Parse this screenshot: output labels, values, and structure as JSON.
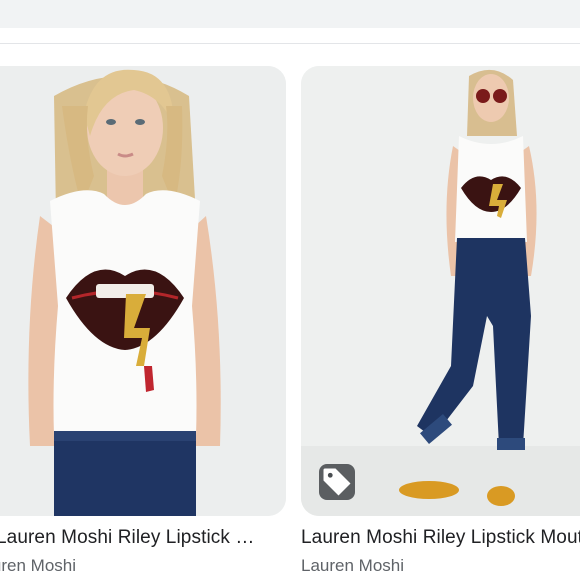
{
  "results": [
    {
      "title": "Lauren Moshi Riley Lipstick Mouth Muscle Tank",
      "seller": "Lauren Moshi",
      "image_alt": "Model wearing white sleeveless tank with red lips and gold lipstick graphic, dark jeans"
    },
    {
      "title": "Lauren Moshi Riley Lipstick Mouth Muscle Tank",
      "seller": "Lauren Moshi",
      "image_alt": "Full-length model in white lips tank, rolled dark skinny jeans, yellow sandals, red sunglasses",
      "badge_icon": "price-tag-icon"
    }
  ],
  "colors": {
    "title": "#202124",
    "seller": "#5f6368",
    "card_bg": "#eef0f0",
    "badge": "#3c4043"
  }
}
